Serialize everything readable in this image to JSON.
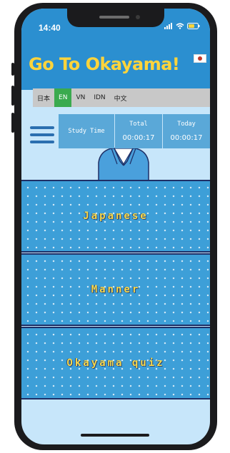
{
  "status_bar": {
    "time": "14:40",
    "icons": [
      "signal-icon",
      "wifi-icon",
      "battery-icon"
    ]
  },
  "header": {
    "title": "Go To Okayama!",
    "flag_icon": "japan-flag-icon"
  },
  "languages": [
    {
      "label": "日本",
      "active": false
    },
    {
      "label": "EN",
      "active": true
    },
    {
      "label": "VN",
      "active": false
    },
    {
      "label": "IDN",
      "active": false
    },
    {
      "label": "中文",
      "active": false
    }
  ],
  "stats": {
    "study_time_label": "Study Time",
    "total_label": "Total",
    "total_value": "00:00:17",
    "today_label": "Today",
    "today_value": "00:00:17"
  },
  "menu": {
    "icon": "hamburger-menu-icon",
    "items": [
      {
        "label": "Japanese"
      },
      {
        "label": "Manner"
      },
      {
        "label": "Okayama quiz"
      }
    ]
  },
  "colors": {
    "header_blue": "#2b8fd0",
    "title_yellow": "#ffd43b",
    "active_language": "#3aaa4e",
    "card_blue": "#3d9fd8",
    "screen_background": "#c7e6fa"
  }
}
